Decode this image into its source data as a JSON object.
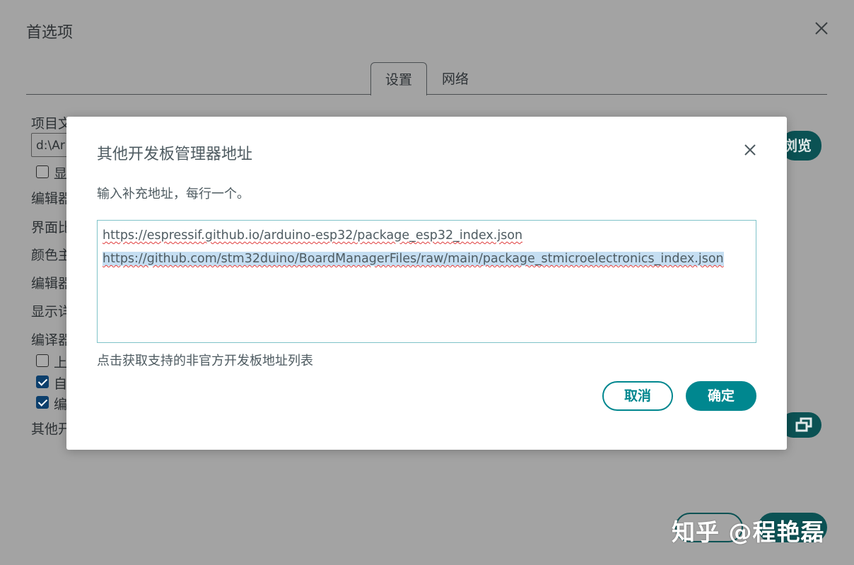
{
  "preferences": {
    "title": "首选项",
    "tabs": [
      {
        "label": "设置"
      },
      {
        "label": "网络"
      }
    ],
    "labels": [
      "项目文件夹地址",
      "编辑器",
      "界面比例",
      "颜色主题",
      "编辑器",
      "显示详细",
      "编译器"
    ],
    "sketchbook_path": "d:\\Ar",
    "checkboxes": [
      {
        "label": "显",
        "checked": false
      },
      {
        "label": "上",
        "checked": false
      },
      {
        "label": "自",
        "checked": true
      },
      {
        "label": "编",
        "checked": true
      }
    ],
    "other_label": "其他开",
    "browse_label": "浏览"
  },
  "dialog": {
    "title": "其他开发板管理器地址",
    "description": "输入补充地址，每行一个。",
    "urls": [
      "https://espressif.github.io/arduino-esp32/package_esp32_index.json",
      "https://github.com/stm32duino/BoardManagerFiles/raw/main/package_stmicroelectronics_index.json"
    ],
    "help_link": "点击获取支持的非官方开发板地址列表",
    "cancel_label": "取消",
    "ok_label": "确定"
  },
  "watermark": "知乎 @程艳磊",
  "colors": {
    "accent": "#00878f",
    "dark_accent": "#0b5254",
    "overlay": "#a3a3a3",
    "selection": "#c5def2"
  }
}
